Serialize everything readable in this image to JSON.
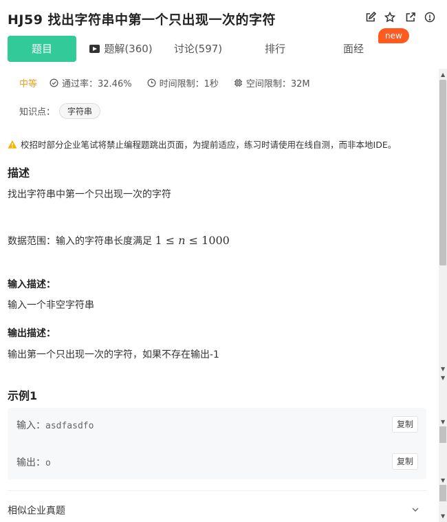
{
  "header": {
    "title": "HJ59  找出字符串中第一个只出现一次的字符",
    "new_badge": "new",
    "icons": [
      "edit-icon",
      "star-icon",
      "share-icon",
      "info-icon"
    ]
  },
  "tabs": [
    {
      "label": "题目"
    },
    {
      "label": "题解(360)"
    },
    {
      "label": "讨论(597)"
    },
    {
      "label": "排行"
    },
    {
      "label": "面经"
    }
  ],
  "meta": {
    "difficulty": "中等",
    "pass_rate": "通过率：32.46%",
    "time_limit": "时间限制：1秒",
    "space_limit": "空间限制：32M"
  },
  "knowledge": {
    "label": "知识点：",
    "tag": "字符串"
  },
  "warning": "校招时部分企业笔试将禁止编程题跳出页面，为提前适应，练习时请使用在线自测，而非本地IDE。",
  "description": {
    "title": "描述",
    "text": "找出字符串中第一个只出现一次的字符",
    "range_prefix": "数据范围：输入的字符串长度满足 ",
    "range_lo": "1",
    "range_le": "≤",
    "range_var": "n",
    "range_hi": "1000"
  },
  "input": {
    "title": "输入描述：",
    "text": "输入一个非空字符串"
  },
  "output": {
    "title": "输出描述：",
    "text": "输出第一个只出现一次的字符，如果不存在输出-1"
  },
  "example": {
    "title": "示例1",
    "input_label": "输入：",
    "input_value": "asdfasdfo",
    "output_label": "输出：",
    "output_value": "o",
    "copy_label": "复制"
  },
  "similar": {
    "label": "相似企业真题"
  },
  "colors": {
    "accent": "#32ca99",
    "difficulty": "#f0a020",
    "badge": "#ff5a1f",
    "warning": "#f5b400"
  }
}
